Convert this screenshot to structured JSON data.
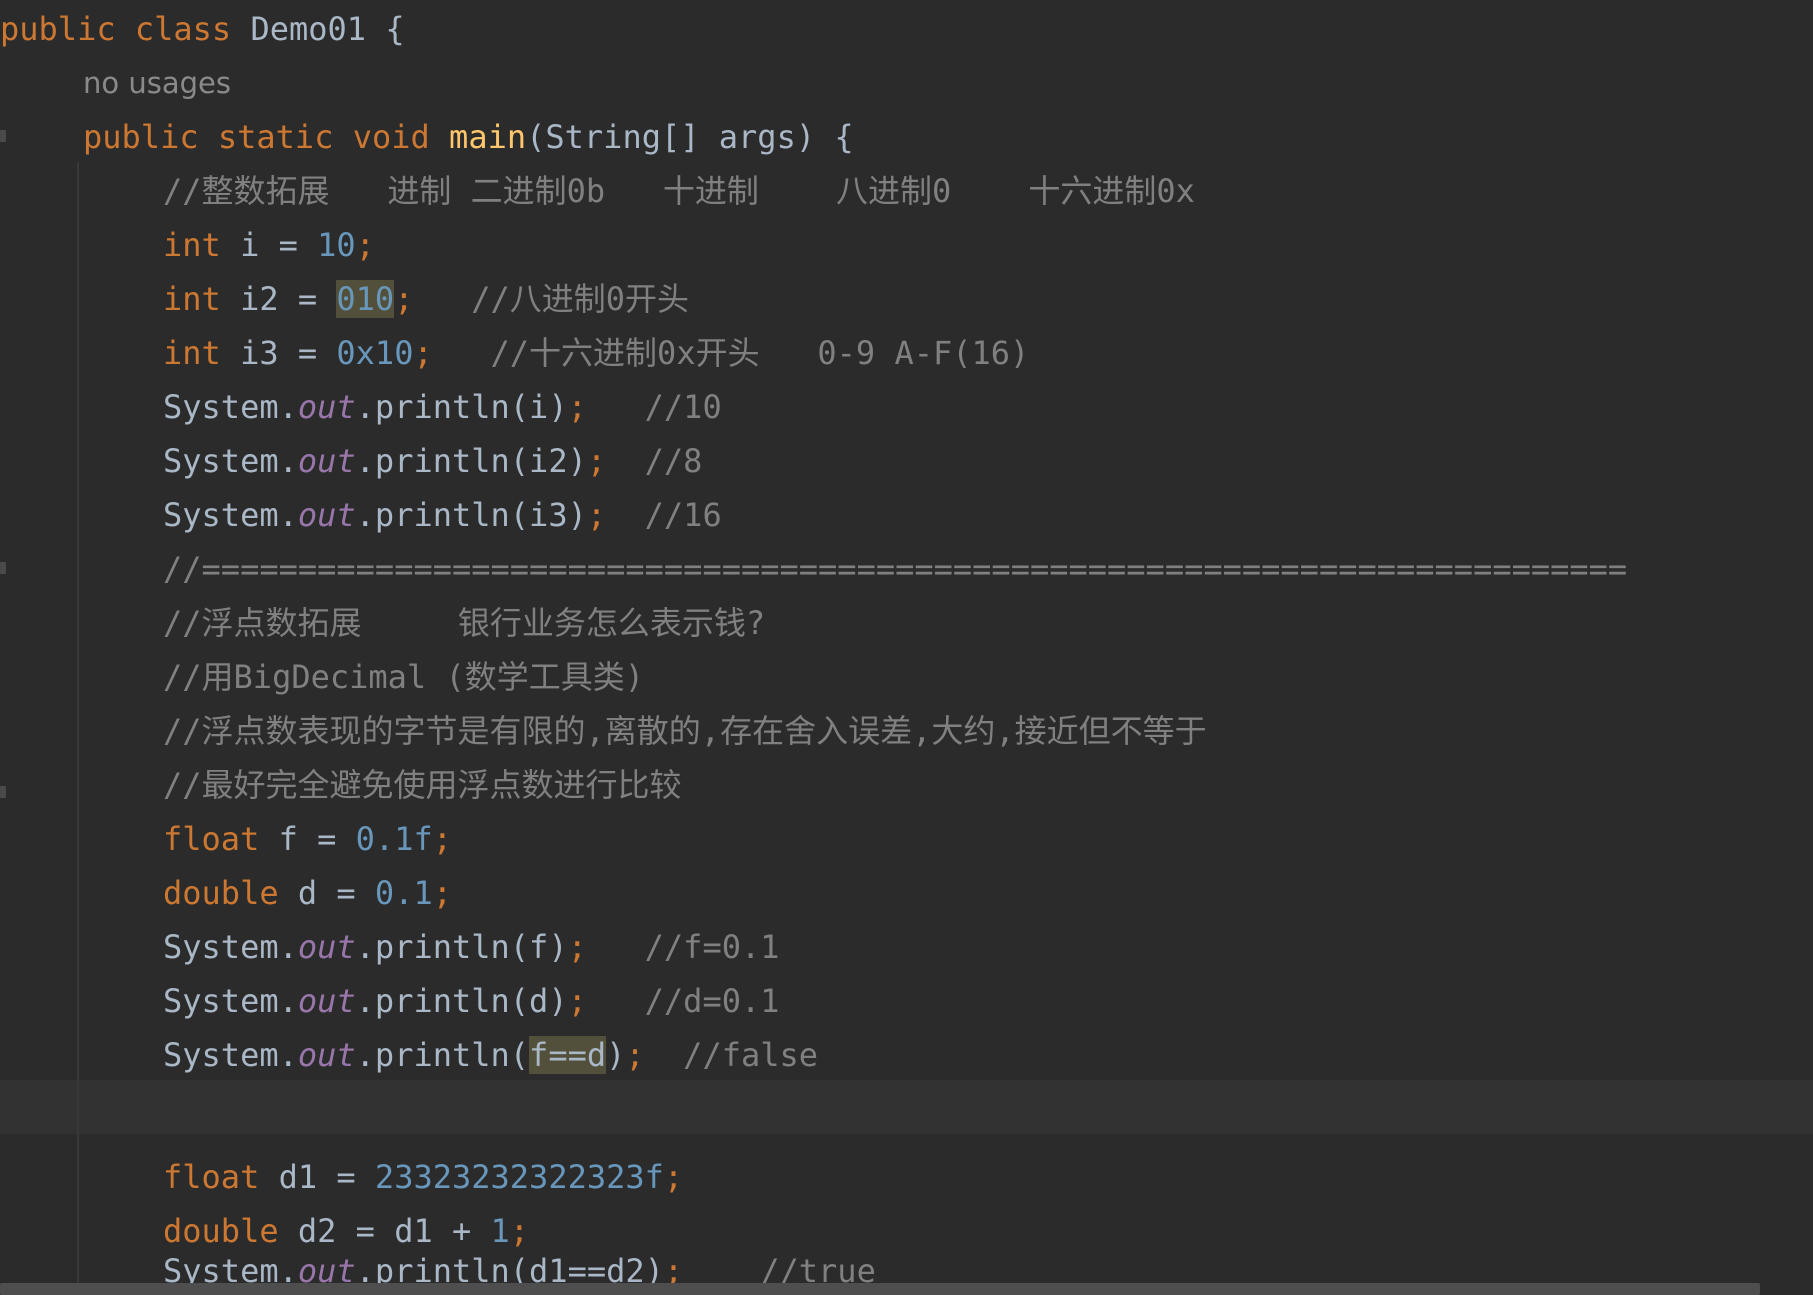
{
  "theme": {
    "background": "#2b2b2b",
    "keyword_color": "#cc7832",
    "number_color": "#6897bb",
    "static_field_color": "#9876aa",
    "comment_color": "#808080",
    "method_decl_color": "#ffc66d",
    "plain_color": "#a9b7c6",
    "usage_highlight": "#52503a"
  },
  "hint": {
    "usages": "no usages"
  },
  "code": {
    "l1": {
      "kw": "public class",
      "rest": " Demo01 {"
    },
    "l3": {
      "kw": "public static void",
      "name": "main",
      "rest": "(String[] args) {"
    },
    "l4": {
      "c": "//整数拓展   进制 二进制0b   十进制    八进制0    十六进制0x"
    },
    "l5": {
      "kw": "int",
      "a": " i = ",
      "num": "10",
      "semi": ";"
    },
    "l6": {
      "kw": "int",
      "a": " i2 = ",
      "num": "010",
      "semi": ";",
      "c": "   //八进制0开头"
    },
    "l7": {
      "kw": "int",
      "a": " i3 = ",
      "num": "0x10",
      "semi": ";",
      "c": "   //十六进制0x开头   0-9 A-F(16)"
    },
    "l8": {
      "sys": "System.",
      "out": "out",
      "call": ".println(i)",
      "semi": ";",
      "c": "   //10"
    },
    "l9": {
      "sys": "System.",
      "out": "out",
      "call": ".println(i2)",
      "semi": ";",
      "c": "  //8"
    },
    "l10": {
      "sys": "System.",
      "out": "out",
      "call": ".println(i3)",
      "semi": ";",
      "c": "  //16"
    },
    "l11": {
      "c": "//=========================================================================="
    },
    "l12": {
      "c": "//浮点数拓展     银行业务怎么表示钱?"
    },
    "l13": {
      "c": "//用BigDecimal (数学工具类)"
    },
    "l14": {
      "c": "//浮点数表现的字节是有限的,离散的,存在舍入误差,大约,接近但不等于"
    },
    "l15": {
      "c": "//最好完全避免使用浮点数进行比较"
    },
    "l16": {
      "kw": "float",
      "a": " f = ",
      "num": "0.1f",
      "semi": ";"
    },
    "l17": {
      "kw": "double",
      "a": " d = ",
      "num": "0.1",
      "semi": ";"
    },
    "l18": {
      "sys": "System.",
      "out": "out",
      "call": ".println(f)",
      "semi": ";",
      "c": "   //f=0.1"
    },
    "l19": {
      "sys": "System.",
      "out": "out",
      "call": ".println(d)",
      "semi": ";",
      "c": "   //d=0.1"
    },
    "l20": {
      "sys": "System.",
      "out": "out",
      "call_a": ".println(",
      "hl": "f==d",
      "call_b": ")",
      "semi": ";",
      "c": "  //false"
    },
    "l22": {
      "kw": "float",
      "a": " d1 = ",
      "num": "23323232322323f",
      "semi": ";"
    },
    "l23": {
      "kw": "double",
      "a": " d2 = d1 + ",
      "num": "1",
      "semi": ";"
    },
    "l24": {
      "sys": "System.",
      "out": "out",
      "call": ".println(d1==d2)",
      "semi": ";",
      "c": "    //true"
    }
  }
}
